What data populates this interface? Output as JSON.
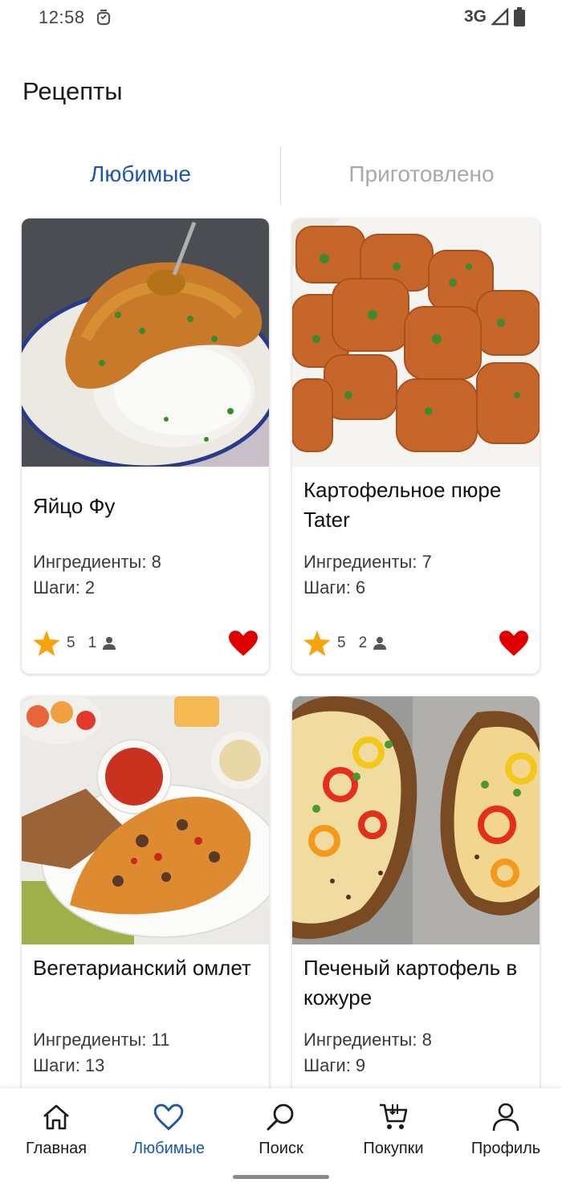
{
  "status_bar": {
    "time": "12:58",
    "network": "3G",
    "icons": [
      "notification-icon",
      "signal-icon",
      "battery-icon"
    ]
  },
  "page": {
    "title": "Рецепты"
  },
  "tabs": [
    {
      "label": "Любимые",
      "active": true
    },
    {
      "label": "Приготовлено",
      "active": false
    }
  ],
  "recipes": [
    {
      "name": "Яйцо Фу",
      "ingredients": "Ингредиенты: 8",
      "steps": "Шаги: 2",
      "rating": "5",
      "users": "1",
      "favorite": true
    },
    {
      "name": "Картофельное пюре Tater",
      "ingredients": "Ингредиенты: 7",
      "steps": "Шаги: 6",
      "rating": "5",
      "users": "2",
      "favorite": true
    },
    {
      "name": "Вегетарианский омлет",
      "ingredients": "Ингредиенты: 11",
      "steps": "Шаги: 13"
    },
    {
      "name": "Печеный картофель в кожуре",
      "ingredients": "Ингредиенты: 8",
      "steps": "Шаги: 9"
    }
  ],
  "bottom_nav": [
    {
      "label": "Главная",
      "icon": "home-icon",
      "active": false
    },
    {
      "label": "Любимые",
      "icon": "heart-outline-icon",
      "active": true
    },
    {
      "label": "Поиск",
      "icon": "search-icon",
      "active": false
    },
    {
      "label": "Покупки",
      "icon": "cart-icon",
      "active": false
    },
    {
      "label": "Профиль",
      "icon": "person-icon",
      "active": false
    }
  ],
  "colors": {
    "accent": "#1f56a8",
    "inactive_tab": "#a9a9a9",
    "heart": "#e00000",
    "star": "#f7a40c"
  }
}
